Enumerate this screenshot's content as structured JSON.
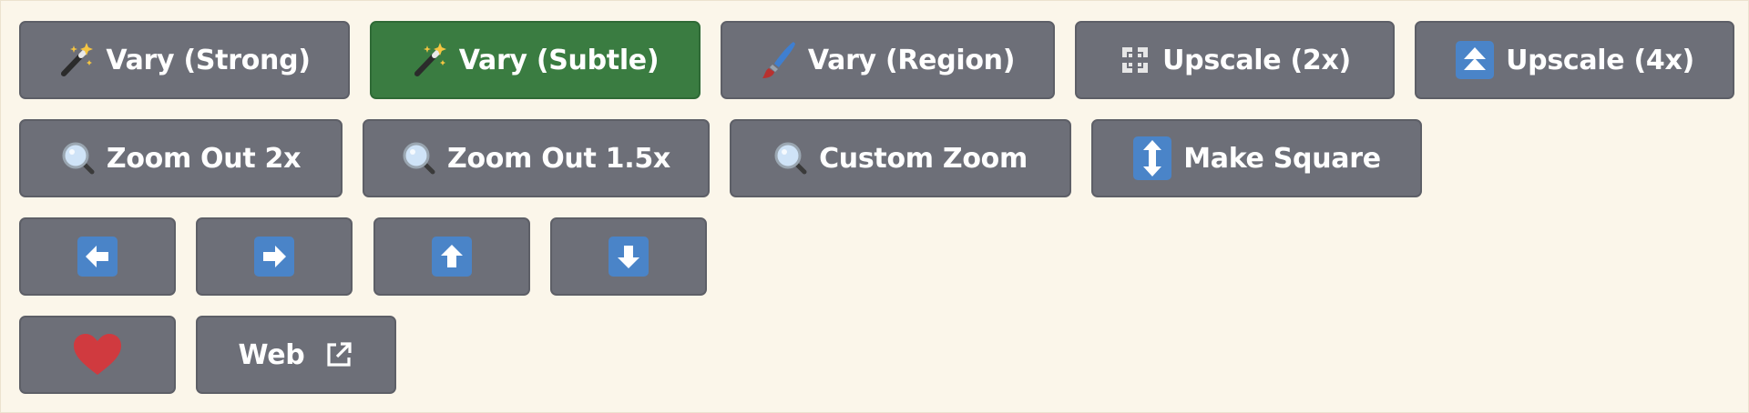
{
  "colors": {
    "background": "#fbf6ea",
    "button": "#6d6f78",
    "button_active": "#3a7c41",
    "icon_blue": "#4a84c8",
    "heart": "#d03a3f"
  },
  "rows": [
    {
      "buttons": [
        {
          "label": "Vary (Strong)",
          "icon": "magic-wand-icon",
          "active": false
        },
        {
          "label": "Vary (Subtle)",
          "icon": "magic-wand-icon",
          "active": true
        },
        {
          "label": "Vary (Region)",
          "icon": "paintbrush-icon",
          "active": false
        },
        {
          "label": "Upscale (2x)",
          "icon": "expand-corners-icon",
          "active": false
        },
        {
          "label": "Upscale (4x)",
          "icon": "double-arrow-up-icon",
          "active": false
        }
      ]
    },
    {
      "buttons": [
        {
          "label": "Zoom Out 2x",
          "icon": "magnifier-icon"
        },
        {
          "label": "Zoom Out 1.5x",
          "icon": "magnifier-icon"
        },
        {
          "label": "Custom Zoom",
          "icon": "magnifier-icon"
        },
        {
          "label": "Make Square",
          "icon": "vertical-arrows-icon"
        }
      ]
    },
    {
      "buttons": [
        {
          "icon": "arrow-left-icon"
        },
        {
          "icon": "arrow-right-icon"
        },
        {
          "icon": "arrow-up-icon"
        },
        {
          "icon": "arrow-down-icon"
        }
      ]
    },
    {
      "buttons": [
        {
          "icon": "heart-icon"
        },
        {
          "label": "Web",
          "icon": "external-link-icon"
        }
      ]
    }
  ]
}
